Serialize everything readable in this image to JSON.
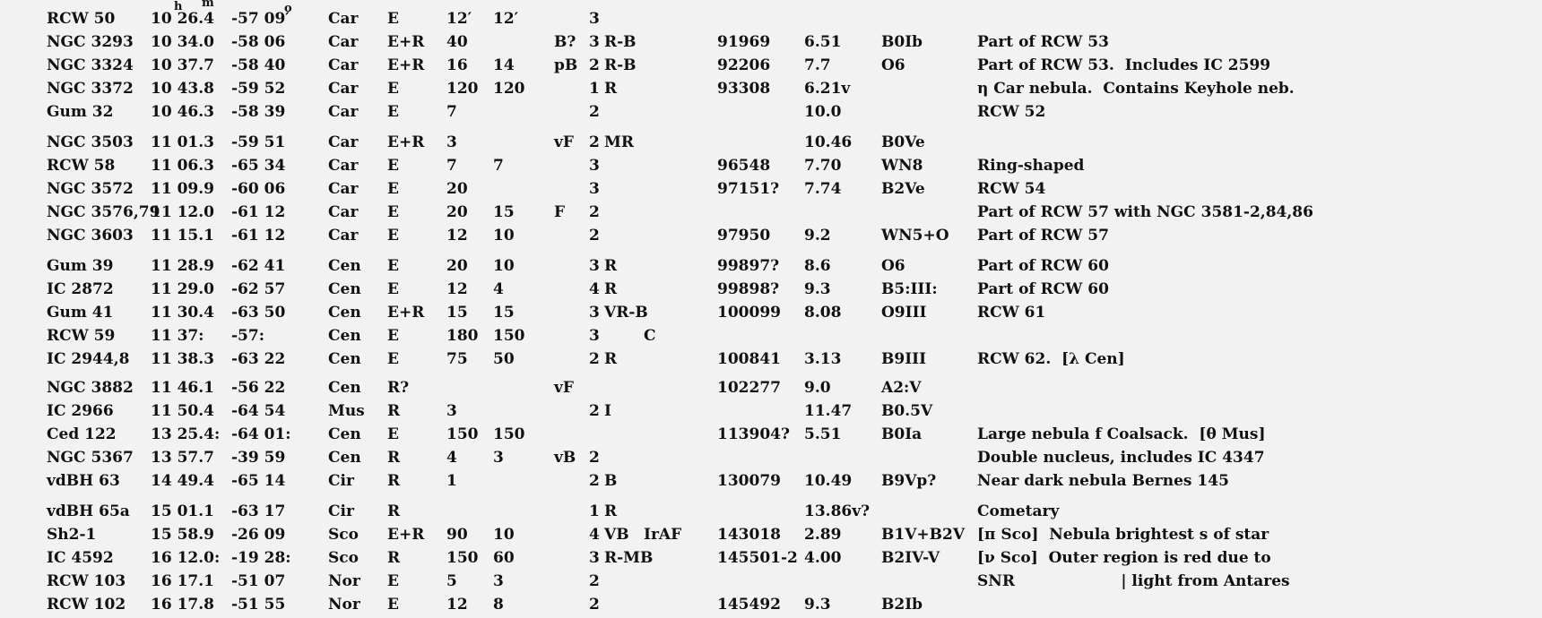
{
  "header_units": {
    "h": "h",
    "m": "m",
    "deg": "o"
  },
  "rows": [
    [
      "RCW 50",
      "10 26.4",
      "-57 09′",
      "Car",
      "E",
      "12′",
      "12′",
      "",
      "3",
      "",
      "",
      "",
      "",
      "",
      "",
      ""
    ],
    [
      "NGC 3293",
      "10 34.0",
      "-58 06",
      "Car",
      "E+R",
      "40",
      "",
      "B?",
      "3",
      "R-B",
      "",
      "91969",
      "6.51",
      "B0Ib",
      "Part of RCW 53"
    ],
    [
      "NGC 3324",
      "10 37.7",
      "-58 40",
      "Car",
      "E+R",
      "16",
      "14",
      "pB",
      "2",
      "R-B",
      "",
      "92206",
      "7.7",
      "O6",
      "Part of RCW 53.  Includes IC 2599"
    ],
    [
      "NGC 3372",
      "10 43.8",
      "-59 52",
      "Car",
      "E",
      "120",
      "120",
      "",
      "1",
      "R",
      "",
      "93308",
      "6.21v",
      "",
      "η Car nebula.  Contains Keyhole neb."
    ],
    [
      "Gum 32",
      "10 46.3",
      "-58 39",
      "Car",
      "E",
      "7",
      "",
      "",
      "2",
      "",
      "",
      "",
      "10.0",
      "",
      "RCW 52"
    ],
    [
      "NGC 3503",
      "11 01.3",
      "-59 51",
      "Car",
      "E+R",
      "3",
      "",
      "vF",
      "2",
      "MR",
      "",
      "",
      "10.46",
      "B0Ve",
      ""
    ],
    [
      "RCW 58",
      "11 06.3",
      "-65 34",
      "Car",
      "E",
      "7",
      "7",
      "",
      "3",
      "",
      "",
      "96548",
      "7.70",
      "WN8",
      "Ring-shaped"
    ],
    [
      "NGC 3572",
      "11 09.9",
      "-60 06",
      "Car",
      "E",
      "20",
      "",
      "",
      "3",
      "",
      "",
      "97151?",
      "7.74",
      "B2Ve",
      "RCW 54"
    ],
    [
      "NGC 3576,79",
      "11 12.0",
      "-61 12",
      "Car",
      "E",
      "20",
      "15",
      "F",
      "2",
      "",
      "",
      "",
      "",
      "",
      "Part of RCW 57 with NGC 3581-2,84,86"
    ],
    [
      "NGC 3603",
      "11 15.1",
      "-61 12",
      "Car",
      "E",
      "12",
      "10",
      "",
      "2",
      "",
      "",
      "97950",
      "9.2",
      "WN5+O",
      "Part of RCW 57"
    ],
    [
      "Gum 39",
      "11 28.9",
      "-62 41",
      "Cen",
      "E",
      "20",
      "10",
      "",
      "3",
      "R",
      "",
      "99897?",
      "8.6",
      "O6",
      "Part of RCW 60"
    ],
    [
      "IC 2872",
      "11 29.0",
      "-62 57",
      "Cen",
      "E",
      "12",
      "4",
      "",
      "4",
      "R",
      "",
      "99898?",
      "9.3",
      "B5:III:",
      "Part of RCW 60"
    ],
    [
      "Gum 41",
      "11 30.4",
      "-63 50",
      "Cen",
      "E+R",
      "15",
      "15",
      "",
      "3",
      "VR-B",
      "",
      "100099",
      "8.08",
      "O9III",
      "RCW 61"
    ],
    [
      "RCW 59",
      "11 37:",
      "-57:",
      "Cen",
      "E",
      "180",
      "150",
      "",
      "3",
      "",
      "C",
      "",
      "",
      "",
      ""
    ],
    [
      "IC 2944,8",
      "11 38.3",
      "-63 22",
      "Cen",
      "E",
      "75",
      "50",
      "",
      "2",
      "R",
      "",
      "100841",
      "3.13",
      "B9III",
      "RCW 62.  [λ Cen]"
    ],
    [
      "NGC 3882",
      "11 46.1",
      "-56 22",
      "Cen",
      "R?",
      "",
      "",
      "vF",
      "",
      "",
      "",
      "102277",
      "9.0",
      "A2:V",
      ""
    ],
    [
      "IC 2966",
      "11 50.4",
      "-64 54",
      "Mus",
      "R",
      "3",
      "",
      "",
      "2",
      "I",
      "",
      "",
      "11.47",
      "B0.5V",
      ""
    ],
    [
      "Ced 122",
      "13 25.4:",
      "-64 01:",
      "Cen",
      "E",
      "150",
      "150",
      "",
      "",
      "",
      "",
      "113904?",
      "5.51",
      "B0Ia",
      "Large nebula f Coalsack.  [θ Mus]"
    ],
    [
      "NGC 5367",
      "13 57.7",
      "-39 59",
      "Cen",
      "R",
      "4",
      "3",
      "vB",
      "2",
      "",
      "",
      "",
      "",
      "",
      "Double nucleus, includes IC 4347"
    ],
    [
      "vdBH 63",
      "14 49.4",
      "-65 14",
      "Cir",
      "R",
      "1",
      "",
      "",
      "2",
      "B",
      "",
      "130079",
      "10.49",
      "B9Vp?",
      "Near dark nebula Bernes 145"
    ],
    [
      "vdBH 65a",
      "15 01.1",
      "-63 17",
      "Cir",
      "R",
      "",
      "",
      "",
      "1",
      "R",
      "",
      "",
      "13.86v?",
      "",
      "Cometary"
    ],
    [
      "Sh2-1",
      "15 58.9",
      "-26 09",
      "Sco",
      "E+R",
      "90",
      "10",
      "",
      "4",
      "VB",
      "IrAF",
      "143018",
      "2.89",
      "B1V+B2V",
      "[π Sco]  Nebula brightest s of star"
    ],
    [
      "IC 4592",
      "16 12.0:",
      "-19 28:",
      "Sco",
      "R",
      "150",
      "60",
      "",
      "3",
      "R-MB",
      "",
      "145501-2",
      "4.00",
      "B2IV-V",
      "[ν Sco]  Outer region is red due to"
    ],
    [
      "RCW 103",
      "16 17.1",
      "-51 07",
      "Nor",
      "E",
      "5",
      "3",
      "",
      "2",
      "",
      "",
      "",
      "",
      "",
      "SNR                    | light from Antares"
    ],
    [
      "RCW 102",
      "16 17.8",
      "-51 55",
      "Nor",
      "E",
      "12",
      "8",
      "",
      "2",
      "",
      "",
      "145492",
      "9.3",
      "B2Ib",
      ""
    ]
  ]
}
